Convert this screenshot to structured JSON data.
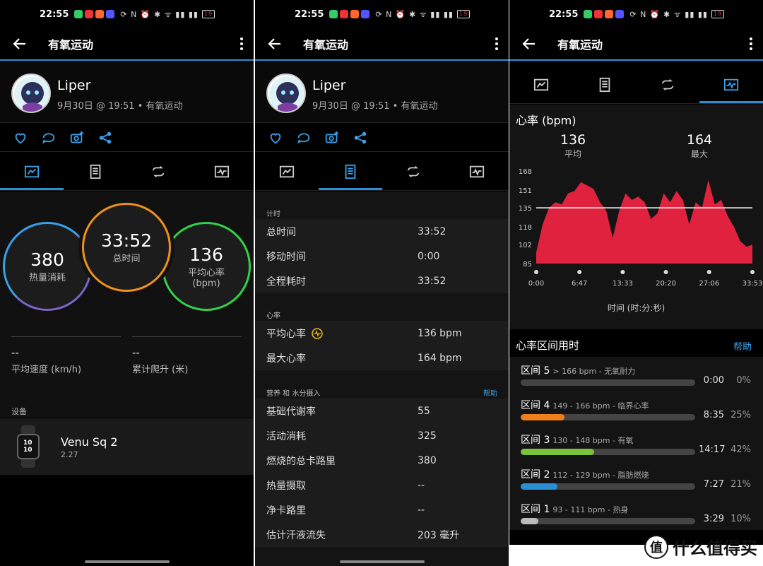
{
  "status": {
    "time": "22:55",
    "battery": "19"
  },
  "appbar": {
    "title": "有氧运动"
  },
  "profile": {
    "name": "Liper",
    "meta": "9月30日 @ 19:51 • 有氧运动"
  },
  "summary": {
    "calories": {
      "value": "380",
      "label": "热量消耗"
    },
    "time": {
      "value": "33:52",
      "label": "总时间"
    },
    "hr": {
      "value": "136",
      "label": "平均心率",
      "unit": "(bpm)"
    },
    "speed": {
      "value": "--",
      "label": "平均速度 (km/h)"
    },
    "climb": {
      "value": "--",
      "label": "累计爬升 (米)"
    },
    "device_section": "设备",
    "device": {
      "name": "Venu Sq 2",
      "version": "2.27",
      "watch_time": "10\n10"
    }
  },
  "details": {
    "groups": [
      {
        "title": "计时",
        "rows": [
          {
            "k": "总时间",
            "v": "33:52"
          },
          {
            "k": "移动时间",
            "v": "0:00"
          },
          {
            "k": "全程耗时",
            "v": "33:52"
          }
        ]
      },
      {
        "title": "心率",
        "rows": [
          {
            "k": "平均心率",
            "v": "136 bpm"
          },
          {
            "k": "最大心率",
            "v": "164 bpm"
          }
        ]
      },
      {
        "title": "营养 和 水分摄入",
        "help": "帮助",
        "rows": [
          {
            "k": "基础代谢率",
            "v": "55"
          },
          {
            "k": "活动消耗",
            "v": "325"
          },
          {
            "k": "燃烧的总卡路里",
            "v": "380"
          },
          {
            "k": "热量摄取",
            "v": "--"
          },
          {
            "k": "净卡路里",
            "v": "--"
          },
          {
            "k": "估计汗液流失",
            "v": "203 毫升"
          }
        ]
      }
    ]
  },
  "hr_chart": {
    "title": "心率 (bpm)",
    "avg": {
      "value": "136",
      "label": "平均"
    },
    "max": {
      "value": "164",
      "label": "最大"
    },
    "xlabel": "时间 (时:分:秒)"
  },
  "chart_data": {
    "type": "area",
    "title": "心率 (bpm)",
    "xlabel": "时间 (时:分:秒)",
    "ylabel": "",
    "y_ticks": [
      "168",
      "151",
      "135",
      "118",
      "102",
      "85"
    ],
    "x_ticks": [
      "0:00",
      "6:47",
      "13:33",
      "20:20",
      "27:06",
      "33:53"
    ],
    "ylim": [
      85,
      168
    ],
    "average_line": 135,
    "series": [
      {
        "x_min": [
          0,
          1,
          2,
          3,
          4,
          5,
          6,
          7,
          8,
          9,
          10,
          11,
          12,
          13,
          14,
          15,
          16,
          17,
          18,
          19,
          20,
          21,
          22,
          23,
          24,
          25,
          26,
          27,
          28,
          29,
          30,
          31,
          32,
          33,
          33.9
        ],
        "values": [
          95,
          120,
          135,
          140,
          138,
          148,
          150,
          158,
          155,
          152,
          140,
          132,
          108,
          132,
          148,
          142,
          145,
          140,
          125,
          130,
          148,
          140,
          150,
          142,
          120,
          140,
          135,
          160,
          138,
          142,
          128,
          118,
          105,
          100,
          102
        ]
      }
    ]
  },
  "zones": {
    "title": "心率区间用时",
    "help": "帮助",
    "items": [
      {
        "name": "区间 5",
        "desc": "> 166 bpm - 无氧耐力",
        "time": "0:00",
        "pct": "0%",
        "fraction": 0.0,
        "color": "#444444"
      },
      {
        "name": "区间 4",
        "desc": "149 - 166 bpm - 临界心率",
        "time": "8:35",
        "pct": "25%",
        "fraction": 0.25,
        "color": "#f07f1b"
      },
      {
        "name": "区间 3",
        "desc": "130 - 148 bpm - 有氧",
        "time": "14:17",
        "pct": "42%",
        "fraction": 0.42,
        "color": "#7ac43a"
      },
      {
        "name": "区间 2",
        "desc": "112 - 129 bpm - 脂肪燃烧",
        "time": "7:27",
        "pct": "21%",
        "fraction": 0.21,
        "color": "#2b8fd6"
      },
      {
        "name": "区间 1",
        "desc": "93 - 111 bpm - 热身",
        "time": "3:29",
        "pct": "10%",
        "fraction": 0.1,
        "color": "#bbbbbb"
      }
    ]
  },
  "watermark": {
    "icon": "值",
    "text": "什么值得买"
  }
}
